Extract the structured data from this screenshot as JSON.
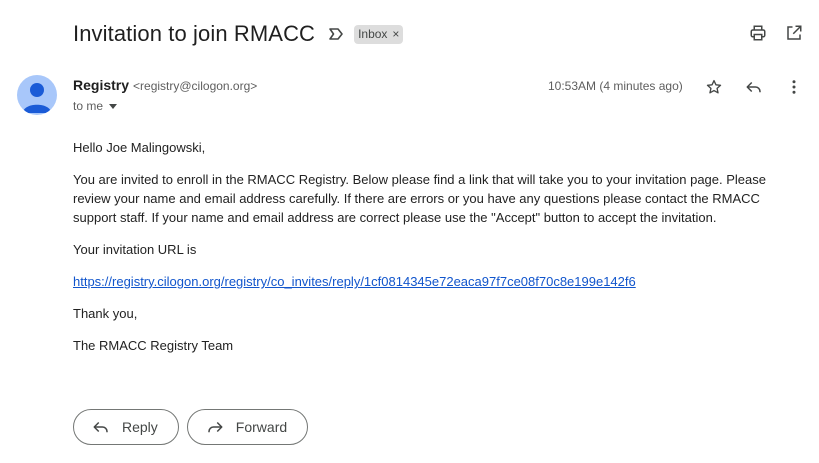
{
  "subject": "Invitation to join RMACC",
  "labels": [
    {
      "name": "Inbox",
      "remove": "×"
    }
  ],
  "icons": {
    "important": "label-important-icon",
    "print": "print-icon",
    "open_new_window": "open-in-new-icon",
    "star": "star-icon",
    "reply": "reply-icon",
    "more": "more-vert-icon",
    "forward": "forward-icon",
    "avatar": "person-avatar-icon"
  },
  "sender": {
    "name": "Registry",
    "email": "<registry@cilogon.org>"
  },
  "recipient": "to me",
  "time": "10:53AM (4 minutes ago)",
  "body": {
    "greeting": "Hello Joe Malingowski,",
    "paragraph": "You are invited to enroll in the RMACC Registry. Below please find a link that will take you to your invitation page. Please review your name and email address carefully. If there are errors or you have any questions please contact the RMACC support staff. If your name and email address are correct please use the \"Accept\" button to accept the invitation.",
    "url_intro": "Your invitation URL is",
    "url": "https://registry.cilogon.org/registry/co_invites/reply/1cf0814345e72eaca97f7ce08f70c8e199e142f6",
    "thanks": "Thank you,",
    "signature": "The RMACC Registry Team"
  },
  "actions": {
    "reply": "Reply",
    "forward": "Forward"
  },
  "colors": {
    "avatar_bg": "#a8c7fa",
    "avatar_fg": "#1a5bd7",
    "link": "#1155cc",
    "chip_bg": "#dddddd"
  }
}
